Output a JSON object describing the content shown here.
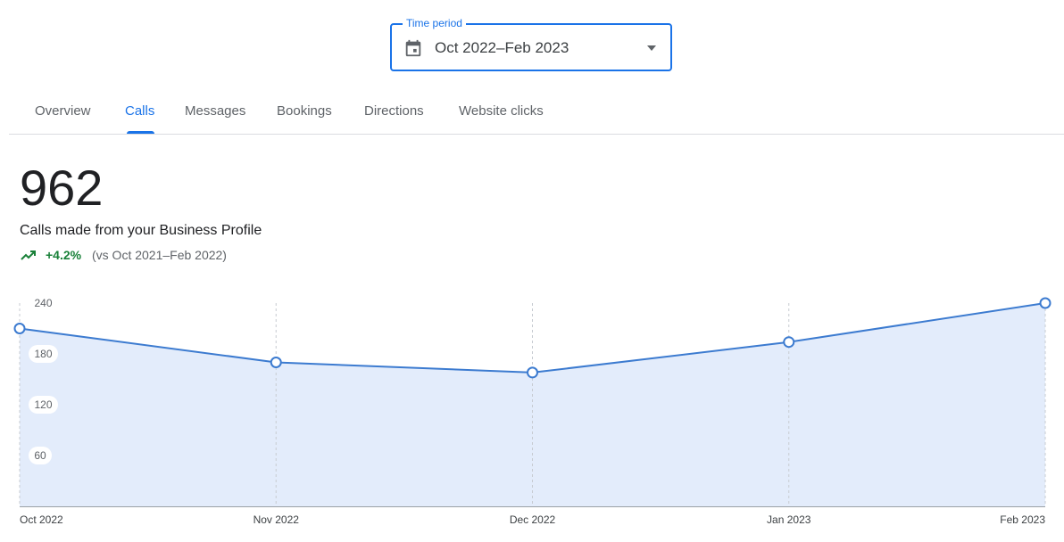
{
  "time_period": {
    "label": "Time period",
    "value": "Oct 2022–Feb 2023"
  },
  "tabs": [
    {
      "label": "Overview",
      "active": false
    },
    {
      "label": "Calls",
      "active": true
    },
    {
      "label": "Messages",
      "active": false
    },
    {
      "label": "Bookings",
      "active": false
    },
    {
      "label": "Directions",
      "active": false
    },
    {
      "label": "Website clicks",
      "active": false
    }
  ],
  "metric": {
    "value": "962",
    "description": "Calls made from your Business Profile",
    "change": "+4.2%",
    "comparison": "(vs Oct 2021–Feb 2022)"
  },
  "colors": {
    "accent": "#1a73e8",
    "positive": "#188038",
    "area_fill": "#e3ecfb",
    "line": "#3c7bd0"
  },
  "icons": {
    "period": "calendar-icon",
    "dropdown": "arrow-drop-down-icon",
    "trend": "trending-up-icon"
  },
  "chart_data": {
    "type": "area",
    "categories": [
      "Oct 2022",
      "Nov 2022",
      "Dec 2022",
      "Jan 2023",
      "Feb 2023"
    ],
    "values": [
      210,
      170,
      158,
      194,
      240
    ],
    "yticks": [
      "60",
      "120",
      "180",
      "240"
    ],
    "ylim": [
      0,
      240
    ],
    "grid": "vertical-dashed",
    "legend": "none"
  }
}
